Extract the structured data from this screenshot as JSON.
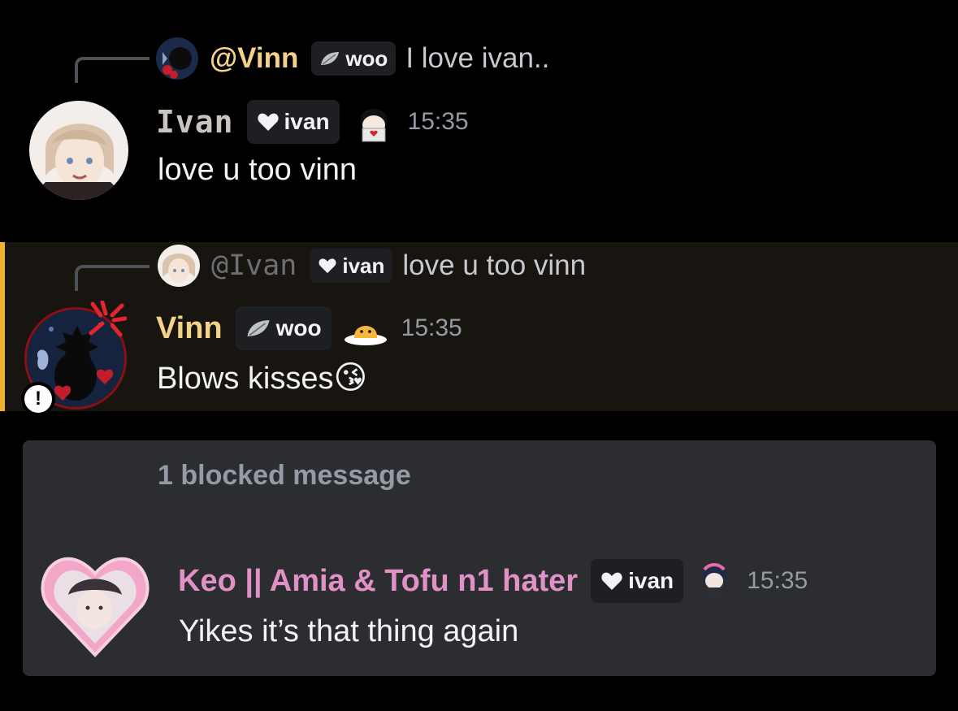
{
  "messages": [
    {
      "reply": {
        "name": "@Vinn",
        "tag": "woo",
        "text": "I love ivan.."
      },
      "author": "Ivan",
      "tag": "ivan",
      "time": "15:35",
      "text": "love u too vinn"
    },
    {
      "reply": {
        "name": "@Ivan",
        "tag": "ivan",
        "text": "love u too vinn"
      },
      "author": "Vinn",
      "tag": "woo",
      "time": "15:35",
      "text": "Blows kisses",
      "emoji": "😘"
    }
  ],
  "blocked": {
    "label": "1 blocked message",
    "message": {
      "author": "Keo || Amia & Tofu n1 hater",
      "tag": "ivan",
      "time": "15:35",
      "text": "Yikes it’s that thing again"
    }
  },
  "colors": {
    "background": "#000000",
    "highlight_bar": "#f0b232",
    "vinn_name": "#f5d28a",
    "keo_name": "#e291c7",
    "ivan_name": "#c9c4bd",
    "timestamp": "#949ba4",
    "panel": "#2b2d31"
  },
  "icons": [
    "reply-connector",
    "heart-icon",
    "leaf-icon",
    "warning-icon",
    "angry-icon",
    "sticker-icon"
  ]
}
